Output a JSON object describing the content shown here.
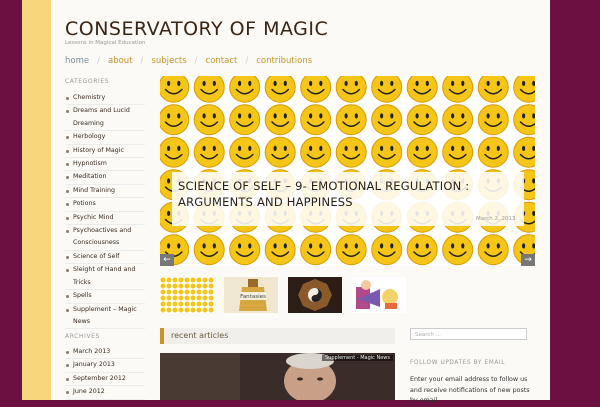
{
  "site": {
    "title": "CONSERVATORY OF MAGIC",
    "tagline": "Lessons in Magical Education"
  },
  "nav": {
    "items": [
      "home",
      "about",
      "subjects",
      "contact",
      "contributions"
    ]
  },
  "sidebar": {
    "categories_heading": "CATEGORIES",
    "categories": [
      "Chemistry",
      "Dreams and Lucid Dreaming",
      "Herbology",
      "History of Magic",
      "Hypnotism",
      "Meditation",
      "Mind Training",
      "Potions",
      "Psychic Mind",
      "Psychoactives and Consciousness",
      "Science of Self",
      "Sleight of Hand and Tricks",
      "Spells",
      "Supplement – Magic News"
    ],
    "archives_heading": "ARCHIVES",
    "archives": [
      "March 2013",
      "January 2013",
      "September 2012",
      "June 2012"
    ]
  },
  "slider": {
    "title": "SCIENCE OF SELF – 9- EMOTIONAL REGULATION : ARGUMENTS AND HAPPINESS",
    "date": "March 2, 2013",
    "prev_icon": "arrow-left-icon",
    "next_icon": "arrow-right-icon",
    "prev_label": "←",
    "next_label": "→"
  },
  "thumbnails": [
    {
      "name": "smiley-thumbnail"
    },
    {
      "name": "fantasies-thumbnail",
      "label": "Fantasies"
    },
    {
      "name": "bagua-thumbnail"
    },
    {
      "name": "magician-thumbnail"
    }
  ],
  "main": {
    "section_title": "recent articles",
    "featured_tag": "Supplement - Magic News"
  },
  "right_sidebar": {
    "search_placeholder": "Search ...",
    "follow_heading": "FOLLOW UPDATES BY EMAIL",
    "follow_text": "Enter your email address to follow us and receive notifications of new posts by email."
  },
  "colors": {
    "background": "#6b1040",
    "accent_stripe": "#f7d57a",
    "link": "#c8932e",
    "smiley": "#f5c518"
  }
}
